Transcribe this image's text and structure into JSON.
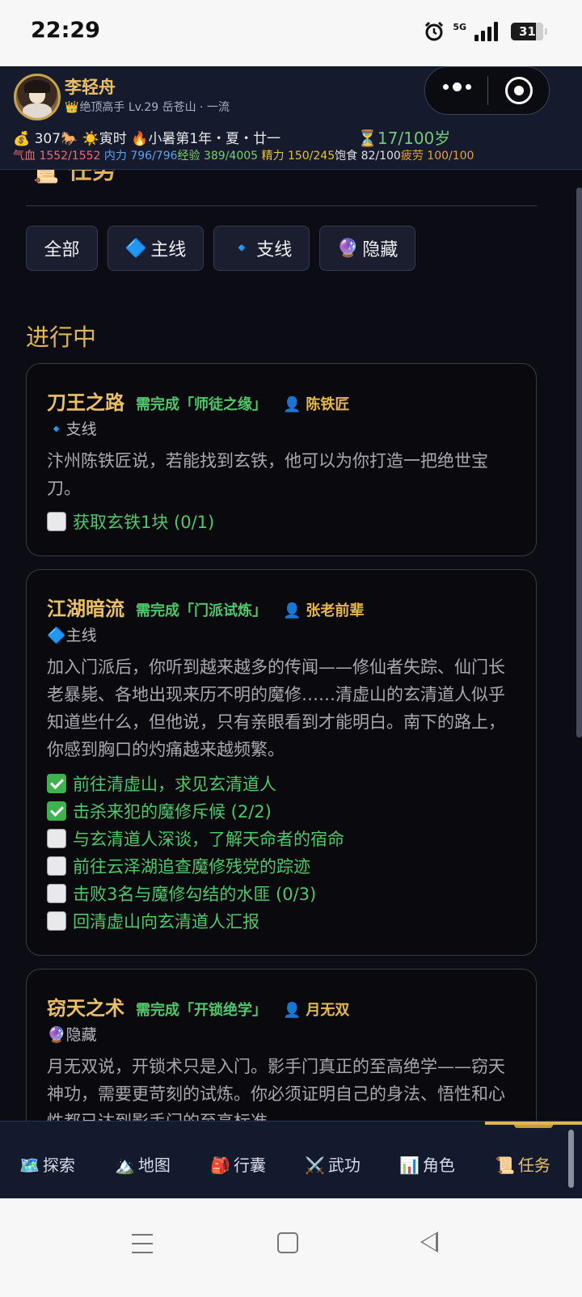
{
  "status_bar": {
    "time": "22:29",
    "network": "5G",
    "battery": "31"
  },
  "player": {
    "name": "李轻舟",
    "title_icon": "👑",
    "title": "绝顶高手 Lv.29 岳苍山 · 一流",
    "money_icon": "💰",
    "money": "307",
    "mount_icon": "🐎",
    "time_icon": "☀️",
    "time": "寅时",
    "season_icon": "🔥",
    "season": "小暑第1年・夏・廿一",
    "age_icon": "⏳",
    "age": "17/100岁",
    "stats": {
      "hp_label": "气血",
      "hp": "1552/1552",
      "mp_label": "内力",
      "mp": "796/796",
      "xp_label": "经验",
      "xp": "389/4005",
      "energy_label": "精力",
      "energy": "150/245",
      "food_label": "饱食",
      "food": "82/100",
      "fatigue_label": "疲劳",
      "fatigue": "100/100"
    }
  },
  "page": {
    "title_icon": "📜",
    "title": "任务",
    "filters": [
      {
        "icon": "",
        "label": "全部"
      },
      {
        "icon": "🔷",
        "label": "主线"
      },
      {
        "icon": "🔹",
        "label": "支线"
      },
      {
        "icon": "🔮",
        "label": "隐藏"
      }
    ],
    "section": "进行中"
  },
  "quests": [
    {
      "name": "刀王之路",
      "requirement": "需完成「师徒之缘」",
      "npc_icon": "👤",
      "npc": "陈铁匠",
      "type_icon": "🔹",
      "type": "支线",
      "desc": "汴州陈铁匠说，若能找到玄铁，他可以为你打造一把绝世宝刀。",
      "objectives": [
        {
          "done": false,
          "text": "获取玄铁1块 (0/1)"
        }
      ]
    },
    {
      "name": "江湖暗流",
      "requirement": "需完成「门派试炼」",
      "npc_icon": "👤",
      "npc": "张老前辈",
      "type_icon": "🔷",
      "type": "主线",
      "desc": "加入门派后，你听到越来越多的传闻——修仙者失踪、仙门长老暴毙、各地出现来历不明的魔修……清虚山的玄清道人似乎知道些什么，但他说，只有亲眼看到才能明白。南下的路上，你感到胸口的灼痛越来越频繁。",
      "objectives": [
        {
          "done": true,
          "text": "前往清虚山，求见玄清道人"
        },
        {
          "done": true,
          "text": "击杀来犯的魔修斥候 (2/2)"
        },
        {
          "done": false,
          "text": "与玄清道人深谈，了解天命者的宿命"
        },
        {
          "done": false,
          "text": "前往云泽湖追查魔修残党的踪迹"
        },
        {
          "done": false,
          "text": "击败3名与魔修勾结的水匪 (0/3)"
        },
        {
          "done": false,
          "text": "回清虚山向玄清道人汇报"
        }
      ]
    },
    {
      "name": "窃天之术",
      "requirement": "需完成「开锁绝学」",
      "npc_icon": "👤",
      "npc": "月无双",
      "type_icon": "🔮",
      "type": "隐藏",
      "desc": "月无双说，开锁术只是入门。影手门真正的至高绝学——窃天神功，需要更苛刻的试炼。你必须证明自己的身法、悟性和心性都已达到影手门的至高标准。",
      "objectives": []
    }
  ],
  "bottom_nav": [
    {
      "icon": "🗺️",
      "label": "探索",
      "active": false
    },
    {
      "icon": "🏔️",
      "label": "地图",
      "active": false
    },
    {
      "icon": "🎒",
      "label": "行囊",
      "active": false
    },
    {
      "icon": "⚔️",
      "label": "武功",
      "active": false
    },
    {
      "icon": "📊",
      "label": "角色",
      "active": false
    },
    {
      "icon": "📜",
      "label": "任务",
      "active": true
    }
  ]
}
